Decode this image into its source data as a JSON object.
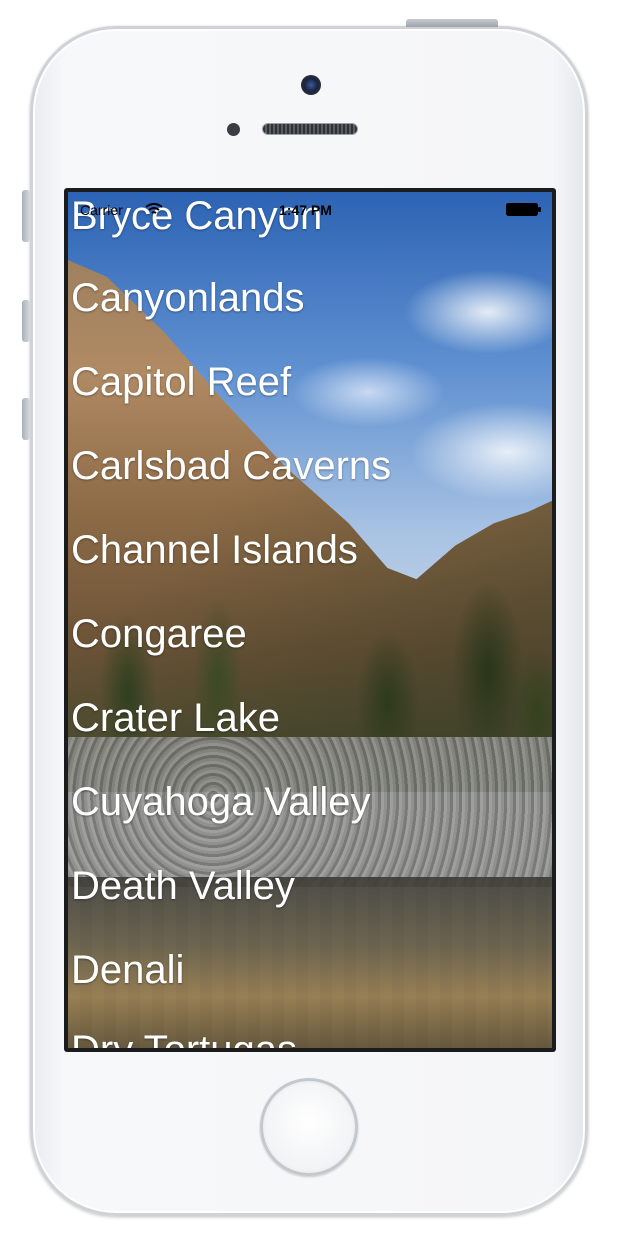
{
  "status_bar": {
    "carrier": "Carrier",
    "wifi_icon": "wifi-icon",
    "time": "1:47 PM",
    "battery_icon": "battery-icon"
  },
  "parks": [
    "Bryce Canyon",
    "Canyonlands",
    "Capitol Reef",
    "Carlsbad Caverns",
    "Channel Islands",
    "Congaree",
    "Crater Lake",
    "Cuyahoga Valley",
    "Death Valley",
    "Denali",
    "Dry Tortugas"
  ],
  "background": {
    "description_icon": "canyon-background-image"
  },
  "device": {
    "home_button_icon": "home-button-icon",
    "camera_icon": "front-camera-icon",
    "speaker_icon": "earpiece-speaker-icon"
  },
  "colors": {
    "text": "#ffffff",
    "device_frame": "#f5f6f8",
    "screen_bezel": "#1b1c1e"
  }
}
